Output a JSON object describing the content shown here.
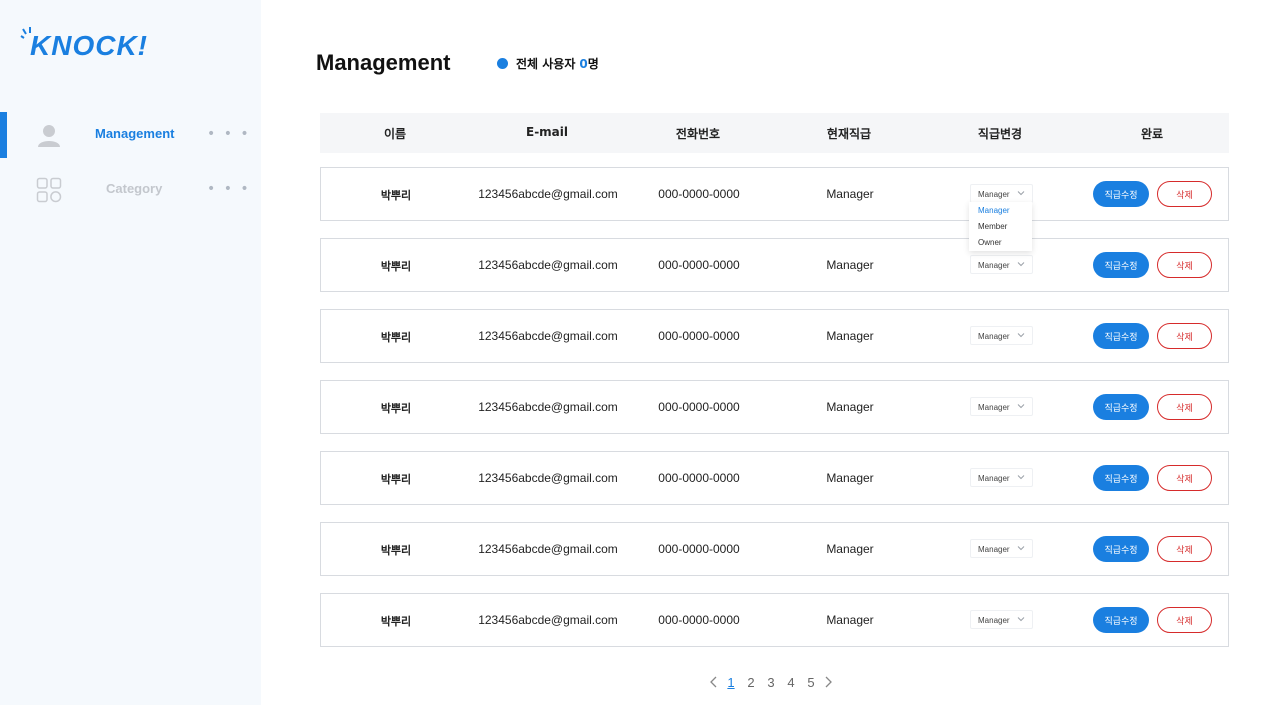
{
  "brand": {
    "logo_text": "KNOCK!",
    "accent": "#1a7fe0",
    "danger": "#d62b2b"
  },
  "sidebar": {
    "items": [
      {
        "label": "Management",
        "icon": "user-icon",
        "active": true,
        "more": "• • •"
      },
      {
        "label": "Category",
        "icon": "grid-icon",
        "active": false,
        "more": "• • •"
      }
    ]
  },
  "page": {
    "title": "Management",
    "user_count_label": "전체 사용자",
    "user_count_value": "0",
    "user_count_unit": "명"
  },
  "table": {
    "headers": [
      "이름",
      "E-mail",
      "전화번호",
      "현재직급",
      "직급변경",
      "완료"
    ],
    "rows": [
      {
        "name": "박뿌리",
        "email": "123456abcde@gmail.com",
        "phone": "000-0000-0000",
        "role": "Manager",
        "select": "Manager",
        "edit": "직급수정",
        "delete": "삭제"
      },
      {
        "name": "박뿌리",
        "email": "123456abcde@gmail.com",
        "phone": "000-0000-0000",
        "role": "Manager",
        "select": "Manager",
        "edit": "직급수정",
        "delete": "삭제"
      },
      {
        "name": "박뿌리",
        "email": "123456abcde@gmail.com",
        "phone": "000-0000-0000",
        "role": "Manager",
        "select": "Manager",
        "edit": "직급수정",
        "delete": "삭제"
      },
      {
        "name": "박뿌리",
        "email": "123456abcde@gmail.com",
        "phone": "000-0000-0000",
        "role": "Manager",
        "select": "Manager",
        "edit": "직급수정",
        "delete": "삭제"
      },
      {
        "name": "박뿌리",
        "email": "123456abcde@gmail.com",
        "phone": "000-0000-0000",
        "role": "Manager",
        "select": "Manager",
        "edit": "직급수정",
        "delete": "삭제"
      },
      {
        "name": "박뿌리",
        "email": "123456abcde@gmail.com",
        "phone": "000-0000-0000",
        "role": "Manager",
        "select": "Manager",
        "edit": "직급수정",
        "delete": "삭제"
      },
      {
        "name": "박뿌리",
        "email": "123456abcde@gmail.com",
        "phone": "000-0000-0000",
        "role": "Manager",
        "select": "Manager",
        "edit": "직급수정",
        "delete": "삭제"
      }
    ]
  },
  "dropdown": {
    "open_row": 0,
    "options": [
      "Manager",
      "Member",
      "Owner"
    ],
    "highlighted": "Manager"
  },
  "pagination": {
    "pages": [
      "1",
      "2",
      "3",
      "4",
      "5"
    ],
    "current": "1"
  }
}
